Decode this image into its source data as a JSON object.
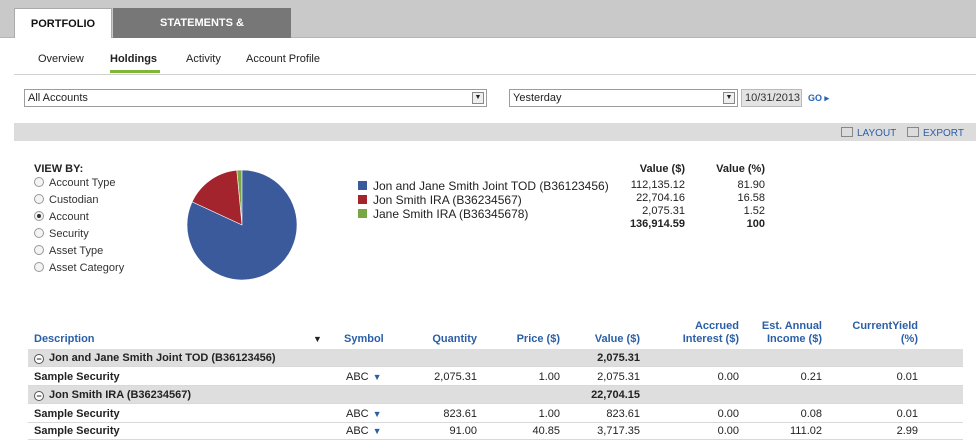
{
  "top_tabs": [
    "PORTFOLIO",
    "STATEMENTS & DOCUMENTS"
  ],
  "sub_tabs": [
    "Overview",
    "Holdings",
    "Activity",
    "Account Profile"
  ],
  "filters": {
    "account": "All Accounts",
    "period": "Yesterday",
    "date": "10/31/2013",
    "go": "GO"
  },
  "tools": {
    "layout": "LAYOUT",
    "export": "EXPORT"
  },
  "view_by": {
    "title": "VIEW BY:",
    "options": [
      "Account Type",
      "Custodian",
      "Account",
      "Security",
      "Asset Type",
      "Asset Category"
    ],
    "selected": "Account"
  },
  "summary": {
    "value_header": "Value ($)",
    "pct_header": "Value (%)",
    "accounts": [
      {
        "name": "Jon and Jane Smith Joint TOD (B36123456)",
        "value": "112,135.12",
        "pct": "81.90",
        "color": "#3a5a9b"
      },
      {
        "name": "Jon Smith IRA (B36234567)",
        "value": "22,704.16",
        "pct": "16.58",
        "color": "#a4242e"
      },
      {
        "name": "Jane Smith IRA (B36345678)",
        "value": "2,075.31",
        "pct": "1.52",
        "color": "#78a642"
      }
    ],
    "total_value": "136,914.59",
    "total_pct": "100"
  },
  "chart_data": {
    "type": "pie",
    "categories": [
      "Jon and Jane Smith Joint TOD (B36123456)",
      "Jon Smith IRA (B36234567)",
      "Jane Smith IRA (B36345678)"
    ],
    "values": [
      81.9,
      16.58,
      1.52
    ],
    "colors": [
      "#3a5a9b",
      "#a4242e",
      "#78a642"
    ]
  },
  "table": {
    "headers": {
      "description": "Description",
      "symbol": "Symbol",
      "quantity": "Quantity",
      "price": "Price ($)",
      "value": "Value ($)",
      "accrued_1": "Accrued",
      "accrued_2": "Interest ($)",
      "income_1": "Est. Annual",
      "income_2": "Income ($)",
      "yield_1": "CurrentYield",
      "yield_2": "(%)"
    },
    "groups": [
      {
        "name": "Jon and Jane Smith Joint TOD (B36123456)",
        "value": "2,075.31",
        "rows": [
          {
            "description": "Sample Security",
            "symbol": "ABC",
            "quantity": "2,075.31",
            "price": "1.00",
            "value": "2,075.31",
            "accrued": "0.00",
            "income": "0.21",
            "yield": "0.01"
          }
        ]
      },
      {
        "name": "Jon Smith IRA (B36234567)",
        "value": "22,704.15",
        "rows": [
          {
            "description": "Sample Security",
            "symbol": "ABC",
            "quantity": "823.61",
            "price": "1.00",
            "value": "823.61",
            "accrued": "0.00",
            "income": "0.08",
            "yield": "0.01"
          },
          {
            "description": "Sample Security",
            "symbol": "ABC",
            "quantity": "91.00",
            "price": "40.85",
            "value": "3,717.35",
            "accrued": "0.00",
            "income": "111.02",
            "yield": "2.99"
          }
        ]
      }
    ]
  }
}
